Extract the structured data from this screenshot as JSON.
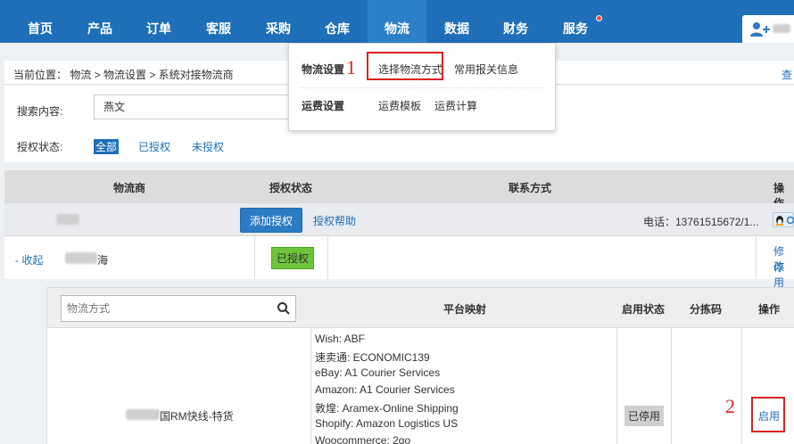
{
  "nav": {
    "items": [
      "首页",
      "产品",
      "订单",
      "客服",
      "采购",
      "仓库",
      "物流",
      "数据",
      "财务",
      "服务"
    ],
    "active": "物流"
  },
  "dropdown": {
    "groups": [
      {
        "title": "物流设置",
        "links": [
          "选择物流方式",
          "常用报关信息"
        ]
      },
      {
        "title": "运费设置",
        "links": [
          "运费模板",
          "运费计算"
        ]
      }
    ]
  },
  "breadcrumb": {
    "text": "当前位置： 物流 > 物流设置 > 系统对接物流商",
    "right": "查"
  },
  "search": {
    "label": "搜索内容:",
    "value": "燕文"
  },
  "auth_filter": {
    "label": "授权状态:",
    "options": [
      "全部",
      "已授权",
      "未授权"
    ],
    "selected": "全部"
  },
  "table": {
    "headers": [
      "物流商",
      "授权状态",
      "联系方式",
      "操作"
    ],
    "row1": {
      "add_auth": "添加授权",
      "auth_help": "授权帮助",
      "contact": "电话：13761515672/1..."
    },
    "row2": {
      "collapse": "- 收起",
      "name_suffix": "海",
      "status": "已授权",
      "actions": [
        "修改",
        "停用"
      ]
    }
  },
  "sub_table": {
    "search_placeholder": "物流方式",
    "headers": [
      "平台映射",
      "启用状态",
      "分拣码",
      "操作"
    ],
    "method_name_suffix": "国RM快线-特货",
    "mappings": [
      "Wish:   ABF",
      "速卖通:   ECONOMIC139",
      "eBay:   A1 Courier Services",
      "Amazon:   A1 Courier Services",
      "敦煌:   Aramex-Online Shipping",
      "Shopify:   Amazon Logistics US",
      "Woocommerce:   2go"
    ],
    "status": "已停用",
    "action": "启用"
  },
  "annotations": [
    "1",
    "2"
  ],
  "colors": {
    "nav_bg": "#1f6fb8",
    "accent": "#2b7cc4",
    "auth_green": "#6ec43a",
    "annotation_red": "#dd2222"
  }
}
